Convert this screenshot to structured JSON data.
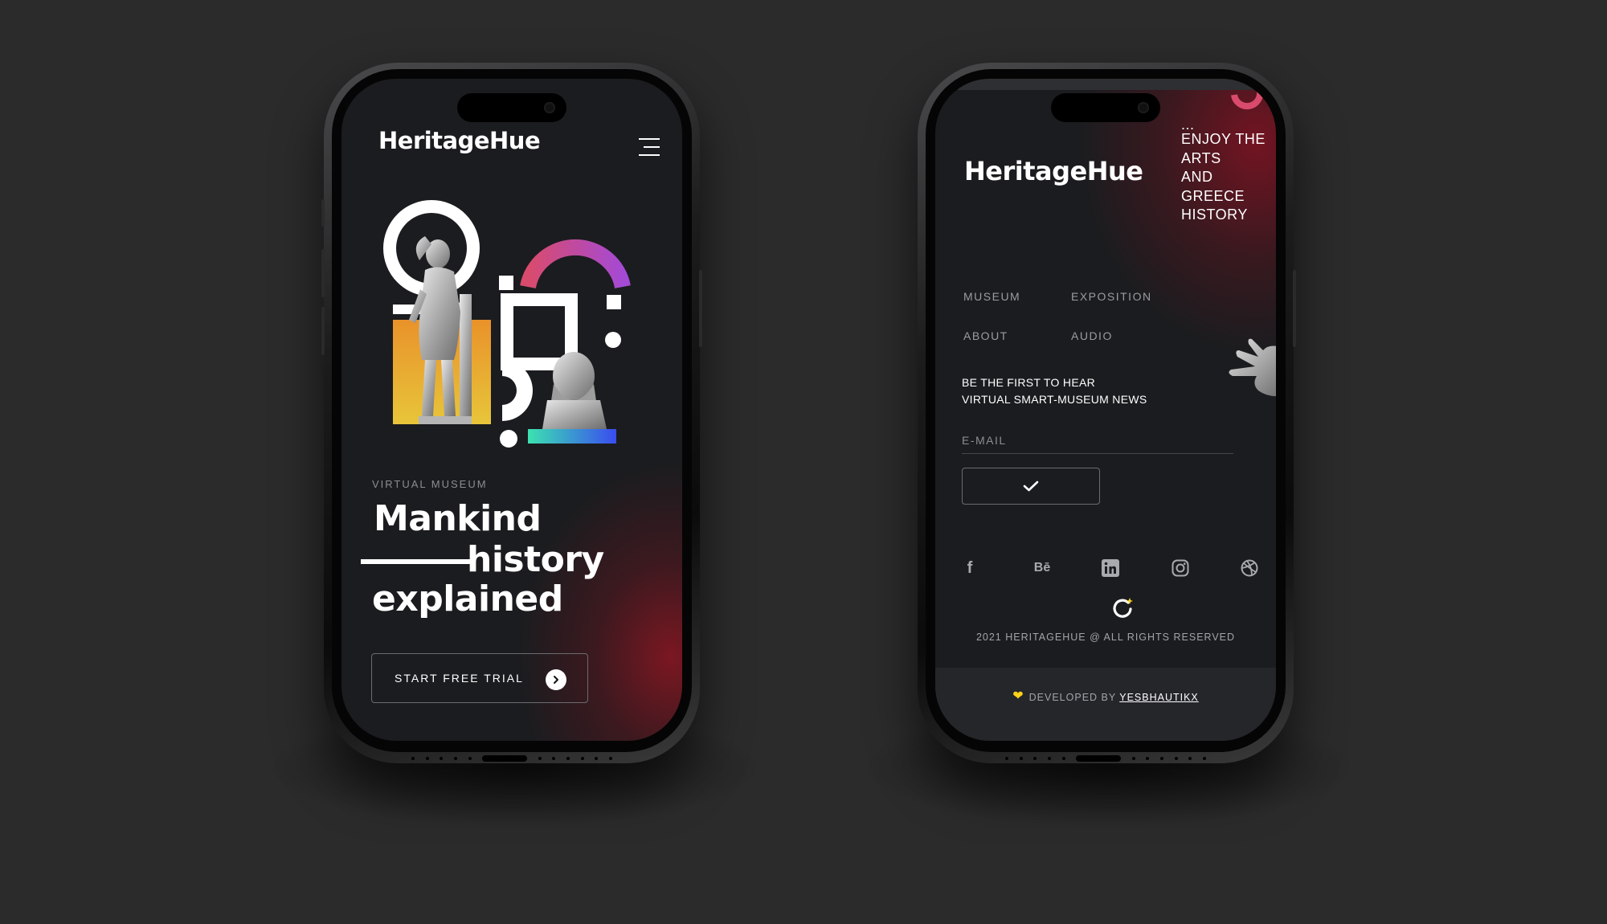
{
  "brand": {
    "name": "HeritageHue",
    "accent_gradient": [
      "#d94b6c",
      "#a54ad4"
    ],
    "bar_gradient": [
      "#3be2b0",
      "#3a4cf0"
    ],
    "panel_gradient": [
      "#e99b2c",
      "#e8772a"
    ],
    "glow_color": "#8c1622"
  },
  "left_screen": {
    "menu_icon": "hamburger-menu-icon",
    "label": "VIRTUAL MUSEUM",
    "headline": {
      "line1": "Mankind",
      "line2": "history",
      "line3": "explained"
    },
    "cta": {
      "label": "START FREE TRIAL",
      "icon": "chevron-right-icon"
    }
  },
  "right_screen": {
    "tagline": {
      "dots": "...",
      "lines": [
        "ENJOY THE",
        "ARTS",
        "AND",
        "GREECE",
        "HISTORY"
      ]
    },
    "nav": [
      "MUSEUM",
      "EXPOSITION",
      "ABOUT",
      "AUDIO"
    ],
    "newsletter": {
      "line1": "BE THE FIRST TO HEAR",
      "line2": "VIRTUAL SMART-MUSEUM NEWS",
      "placeholder": "E-MAIL",
      "submit_icon": "checkmark-icon"
    },
    "social": [
      {
        "name": "facebook",
        "glyph": "f"
      },
      {
        "name": "behance",
        "glyph": "Bē"
      },
      {
        "name": "linkedin",
        "glyph": "in"
      },
      {
        "name": "instagram",
        "glyph": ""
      },
      {
        "name": "dribbble",
        "glyph": ""
      }
    ],
    "copyright": "2021 HERITAGEHUE @ ALL RIGHTS RESERVED",
    "developed_by": "DEVELOPED BY",
    "developer": "YESBHAUTIKX"
  }
}
